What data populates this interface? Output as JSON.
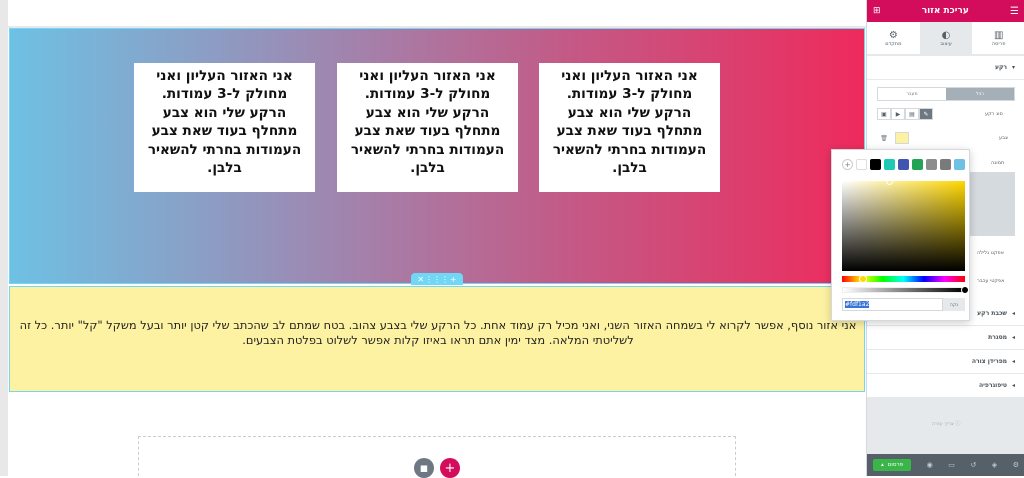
{
  "columns": [
    "אני האזור העליון ואני מחולק ל-3 עמודות. הרקע שלי הוא צבע מתחלף בעוד שאת צבע העמודות בחרתי להשאיר בלבן.",
    "אני האזור העליון ואני מחולק ל-3 עמודות. הרקע שלי הוא צבע מתחלף בעוד שאת צבע העמודות בחרתי להשאיר בלבן.",
    "אני האזור העליון ואני מחולק ל-3 עמודות. הרקע שלי הוא צבע מתחלף בעוד שאת צבע העמודות בחרתי להשאיר בלבן."
  ],
  "section_handle": {
    "close": "✕",
    "move": "⋮⋮⋮",
    "add": "+"
  },
  "section2_text": "אני אזור נוסף, אפשר לקרוא לי בשמחה האזור השני, ואני מכיל רק עמוד אחת. כל הרקע שלי בצבע צהוב. בטח שמתם לב שהכתב שלי קטן יותר ובעל משקל \"קל\" יותר. כל זה לשליטתי המלאה. מצד ימין אתם תראו באיזו קלות אפשר לשלוט בפלטת הצבעים.",
  "panel": {
    "title": "עריכת אזור",
    "tabs": [
      {
        "label": "מתקדם",
        "icon": "gear-icon"
      },
      {
        "label": "עיצוב",
        "icon": "contrast-icon"
      },
      {
        "label": "פריסה",
        "icon": "layout-icon"
      }
    ],
    "background_section": "רקע",
    "seg_normal": "רגיל",
    "seg_hover": "מעבר",
    "label_type": "סוג רקע",
    "label_color": "צבע",
    "label_image": "תמונה",
    "label_gallery": "אפקט גלילה",
    "label_mouse": "אפקטי עכבר",
    "sections": [
      "שכבת רקע",
      "מסגרת",
      "מפרידן צורה",
      "טיפוגרפיה"
    ],
    "help": "צריך עזרה",
    "publish": "פרסום"
  },
  "picker": {
    "swatches": [
      "#ffffff",
      "#000000",
      "#20c9b4",
      "#4054b2",
      "#23a455",
      "#8d8d8d",
      "#7a7a7a",
      "#6ec1e4"
    ],
    "hex_value": "#fdf1a2",
    "clear": "נקה"
  },
  "colors": {
    "accent": "#d30c5c",
    "yellow": "#fdf1a2",
    "gradient_start": "#6ec1e4",
    "gradient_end": "#ee2a5c"
  }
}
